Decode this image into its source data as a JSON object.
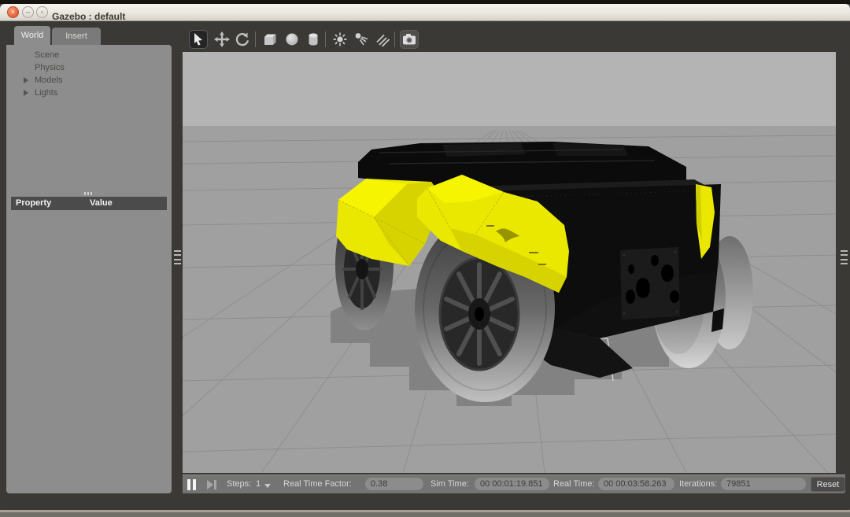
{
  "window": {
    "title": "Gazebo : default",
    "buttons": {
      "close": "×",
      "minimize": "–",
      "maximize": "□"
    }
  },
  "sidebar": {
    "tabs": [
      {
        "label": "World",
        "active": true
      },
      {
        "label": "Insert",
        "active": false
      }
    ],
    "tree_items": [
      {
        "label": "Scene",
        "expandable": false
      },
      {
        "label": "Physics",
        "expandable": false
      },
      {
        "label": "Models",
        "expandable": true
      },
      {
        "label": "Lights",
        "expandable": true
      }
    ],
    "property_header": {
      "property": "Property",
      "value": "Value"
    }
  },
  "toolbar": {
    "tools": [
      "select",
      "translate",
      "rotate",
      "box",
      "sphere",
      "cylinder",
      "point-light",
      "spot-light",
      "directional-light",
      "screenshot"
    ],
    "active_tool": "select"
  },
  "statusbar": {
    "steps_label": "Steps:",
    "steps_value": "1",
    "rtf_label": "Real Time Factor:",
    "rtf_value": "0.38",
    "sim_time_label": "Sim Time:",
    "sim_time_value": "00 00:01:19.851",
    "real_time_label": "Real Time:",
    "real_time_value": "00 00:03:58.263",
    "iterations_label": "Iterations:",
    "iterations_value": "79851",
    "reset_label": "Reset"
  },
  "viewport": {
    "scene_elements": [
      "ground-plane-grid",
      "robot-model",
      "robot-shadow"
    ],
    "colors": {
      "sky": "#b4b4b4",
      "ground": "#a0a0a0",
      "grid_line": "#8e8e8e",
      "robot_accent_yellow": "#eae700",
      "robot_body_black": "#0d0d0d"
    }
  }
}
